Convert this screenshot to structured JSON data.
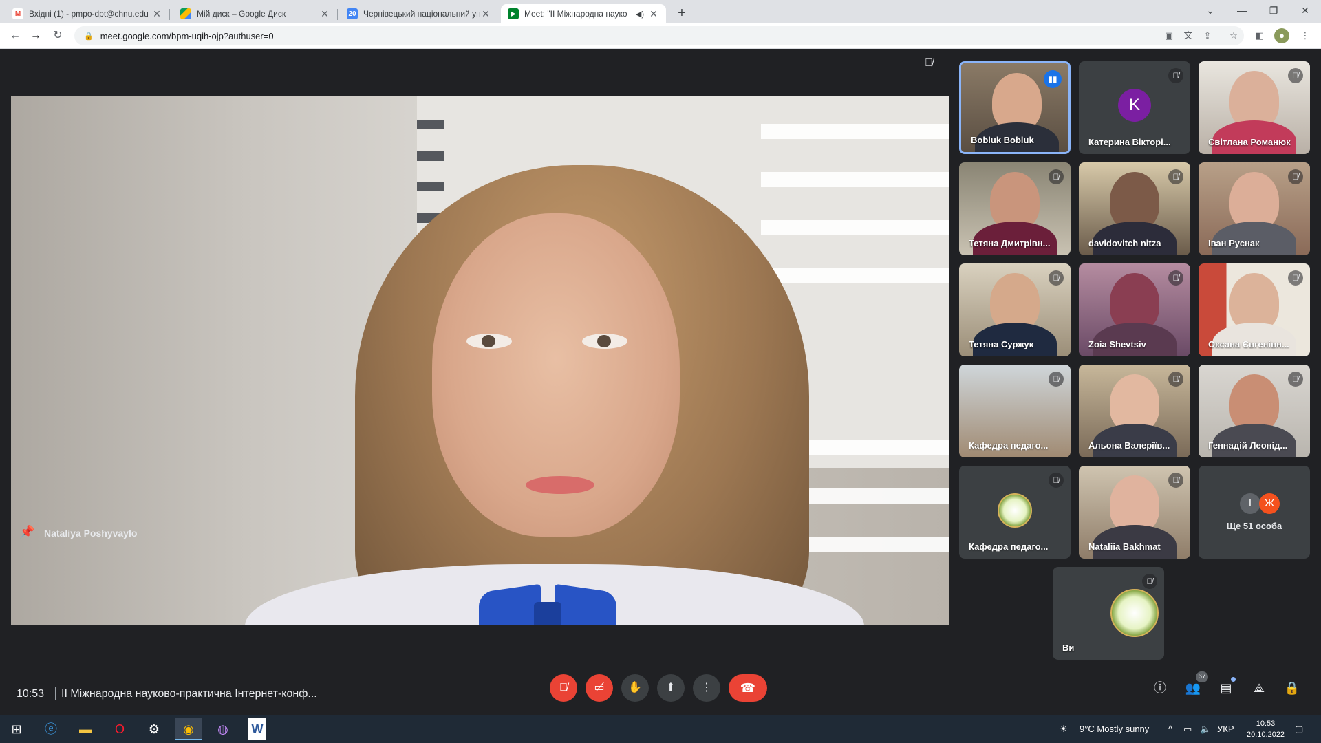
{
  "browser": {
    "tabs": [
      {
        "title": "Вхідні (1) - pmpo-dpt@chnu.edu",
        "favicon": "gmail-icon",
        "active": false
      },
      {
        "title": "Мій диск – Google Диск",
        "favicon": "google-drive-icon",
        "active": false
      },
      {
        "title": "Чернівецький національний ун",
        "favicon": "calendar-icon",
        "active": false
      },
      {
        "title": "Meet: \"ІІ Міжнародна науко",
        "favicon": "meet-icon",
        "active": true
      }
    ],
    "url": "meet.google.com/bpm-uqih-ojp?authuser=0"
  },
  "meet": {
    "main_speaker": "Nataliya Poshyvaylo",
    "participants": [
      {
        "name": "Bobluk Bobluk",
        "speaking": true
      },
      {
        "name": "Катерина Вікторі...",
        "avatar_letter": "K",
        "avatar_color": "#7b1fa2"
      },
      {
        "name": "Світлана Романюк"
      },
      {
        "name": "Тетяна Дмитрівн..."
      },
      {
        "name": "davidovitch nitza"
      },
      {
        "name": "Іван Руснак"
      },
      {
        "name": "Тетяна Суржук"
      },
      {
        "name": "Zoia Shevtsiv"
      },
      {
        "name": "Оксана Євгенівн..."
      },
      {
        "name": "Кафедра педаго..."
      },
      {
        "name": "Альона Валеріїв..."
      },
      {
        "name": "Геннадій Леонід..."
      },
      {
        "name": "Кафедра педаго..."
      },
      {
        "name": "Nataliia Bakhmat"
      }
    ],
    "more": {
      "label": "Ще 51 особа",
      "avatar_1": "І",
      "avatar_1_color": "#5f6368",
      "avatar_2": "Ж",
      "avatar_2_color": "#f4511e"
    },
    "self_label": "Ви",
    "clock": "10:53",
    "meeting_title": "ІІ Міжнародна науково-практична Інтернет-конф...",
    "people_count": "67",
    "accent_end_call": "#ea4335"
  },
  "taskbar": {
    "weather": "9°C  Mostly sunny",
    "language": "УКР",
    "time": "10:53",
    "date": "20.10.2022"
  }
}
